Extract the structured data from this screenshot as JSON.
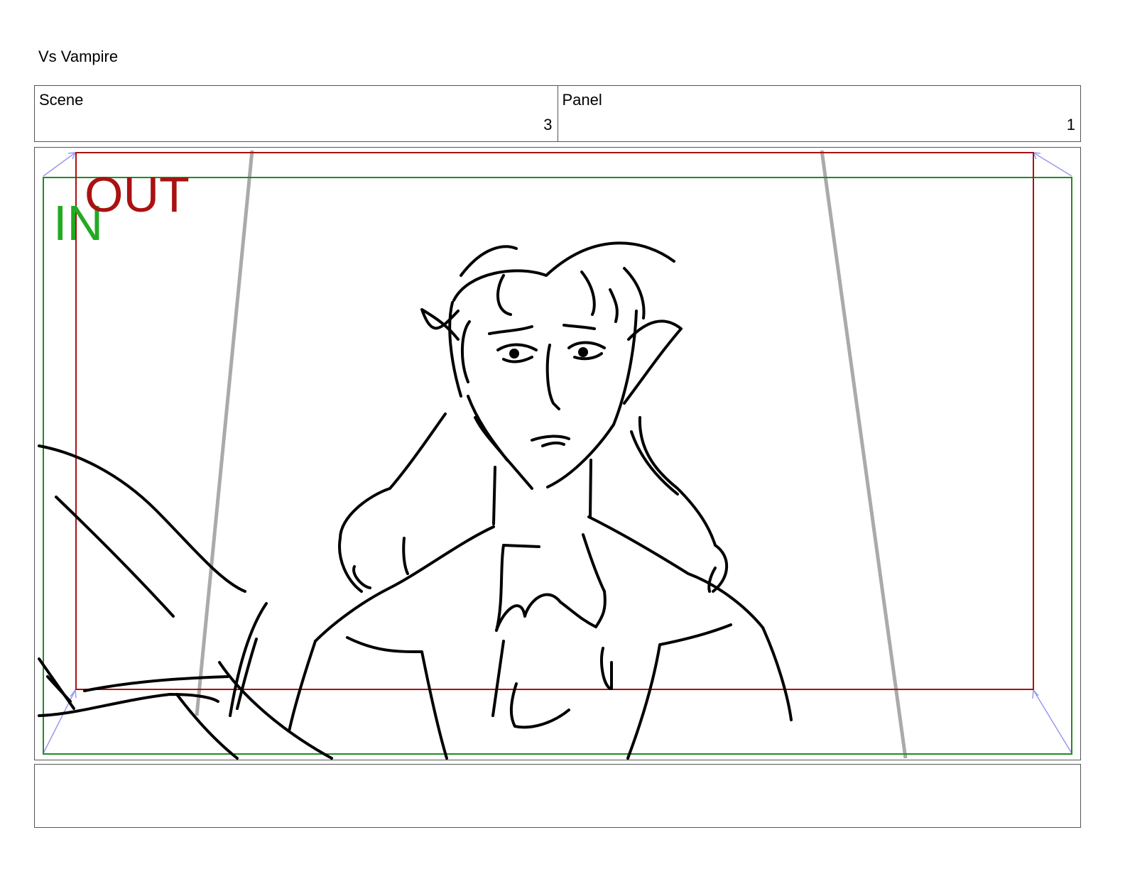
{
  "page": {
    "title": "Vs Vampire"
  },
  "header": {
    "scene_label": "Scene",
    "scene_value": "3",
    "panel_label": "Panel",
    "panel_value": "1"
  },
  "panel": {
    "in_label": "IN",
    "out_label": "OUT",
    "in_color": "#22aa22",
    "out_color": "#aa1111",
    "guide_color": "#aaaaaa",
    "camera_arrow_color": "#9999ee"
  },
  "notes": {
    "text": ""
  }
}
